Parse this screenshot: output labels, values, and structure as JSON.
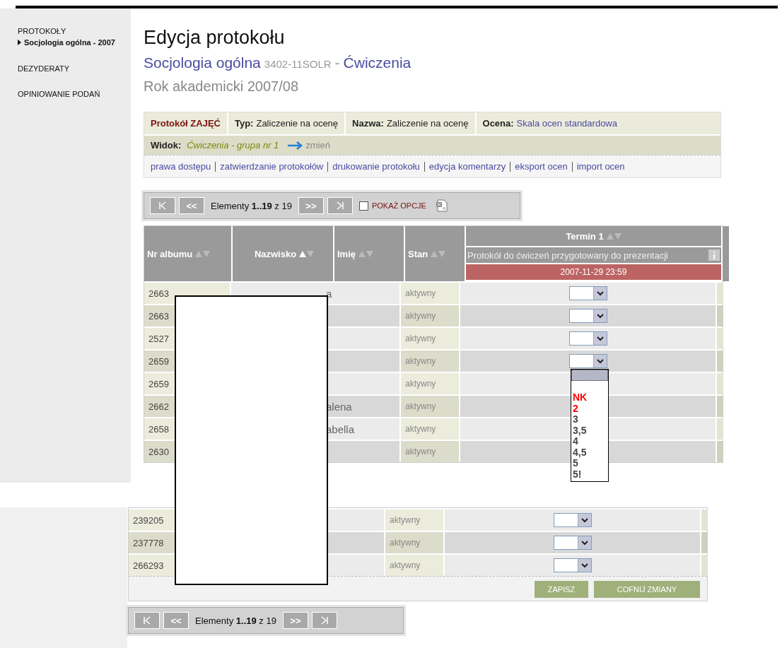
{
  "sidebar": {
    "items": [
      {
        "label": "PROTOKOŁY",
        "selected": false,
        "children": [
          {
            "label": "Socjologia ogólna - 2007",
            "selected": true
          }
        ]
      },
      {
        "label": "DEZYDERATY",
        "selected": false
      },
      {
        "label": "OPINIOWANIE PODAŃ",
        "selected": false
      }
    ]
  },
  "header": {
    "title": "Edycja protokołu",
    "subject": "Socjologia ogólna",
    "code": "3402-11SOLR",
    "separator": "-",
    "class_type": "Ćwiczenia",
    "year": "Rok akademicki 2007/08"
  },
  "info": {
    "protocol": "Protokół ZAJĘĆ",
    "fields": [
      {
        "label": "Typ:",
        "value": "Zaliczenie na ocenę",
        "kind": "text"
      },
      {
        "label": "Nazwa:",
        "value": "Zaliczenie na ocenę",
        "kind": "text"
      },
      {
        "label": "Ocena:",
        "value": "Skala ocen standardowa",
        "kind": "link"
      }
    ],
    "view": {
      "label": "Widok:",
      "value": "Ćwiczenia - grupa nr 1",
      "action": "zmień"
    },
    "links": [
      "prawa dostępu",
      "zatwierdzanie protokołów",
      "drukowanie protokołu",
      "edycja komentarzy",
      "eksport ocen",
      "import ocen"
    ]
  },
  "pager_top": {
    "prev": "<<",
    "status": "Elementy **1..19** z 19",
    "next": ">>",
    "options": {
      "label": "POKAŻ OPCJE",
      "checked": false
    }
  },
  "table": {
    "columns": [
      {
        "label": "Nr albumu",
        "sorted": false
      },
      {
        "label": "Nazwisko",
        "sorted": true
      },
      {
        "label": "Imię",
        "sorted": false
      },
      {
        "label": "Stan",
        "sorted": false
      }
    ],
    "term": {
      "label": "Termin 1",
      "subtitle": "Protokół do ćwiczeń przygotowany do prezentacji",
      "deadline": "2007-11-29 23:59"
    },
    "rows_top": [
      {
        "album": "2663",
        "name": "a",
        "status": "aktywny"
      },
      {
        "album": "2663",
        "status": "aktywny"
      },
      {
        "album": "2527",
        "status": "aktywny"
      },
      {
        "album": "2659",
        "status": "aktywny",
        "grade_options": [
          {
            "label": "NK",
            "color": "#ff0000"
          },
          {
            "label": "2",
            "color": "#ff0000"
          },
          {
            "label": "3",
            "color": "#444444"
          },
          {
            "label": "3,5",
            "color": "#444444"
          },
          {
            "label": "4",
            "color": "#444444"
          },
          {
            "label": "4,5",
            "color": "#444444"
          },
          {
            "label": "5",
            "color": "#444444"
          },
          {
            "label": "5!",
            "color": "#444444"
          }
        ]
      },
      {
        "album": "2659",
        "status": "aktywny"
      },
      {
        "album": "2662",
        "name": "alena",
        "status": "aktywny"
      },
      {
        "album": "2658",
        "name": "abella",
        "status": "aktywny"
      },
      {
        "album": "2630",
        "status": "aktywny"
      }
    ],
    "rows_bottom": [
      {
        "album": "239205",
        "status": "aktywny"
      },
      {
        "album": "237778",
        "status": "aktywny"
      },
      {
        "album": "266293",
        "status": "aktywny"
      }
    ]
  },
  "actions": [
    "ZAPISZ",
    "COFNIJ ZMIANY"
  ],
  "pager_bottom": {
    "prev": "<<",
    "status": "Elementy **1..19** z 19",
    "next": ">>"
  }
}
